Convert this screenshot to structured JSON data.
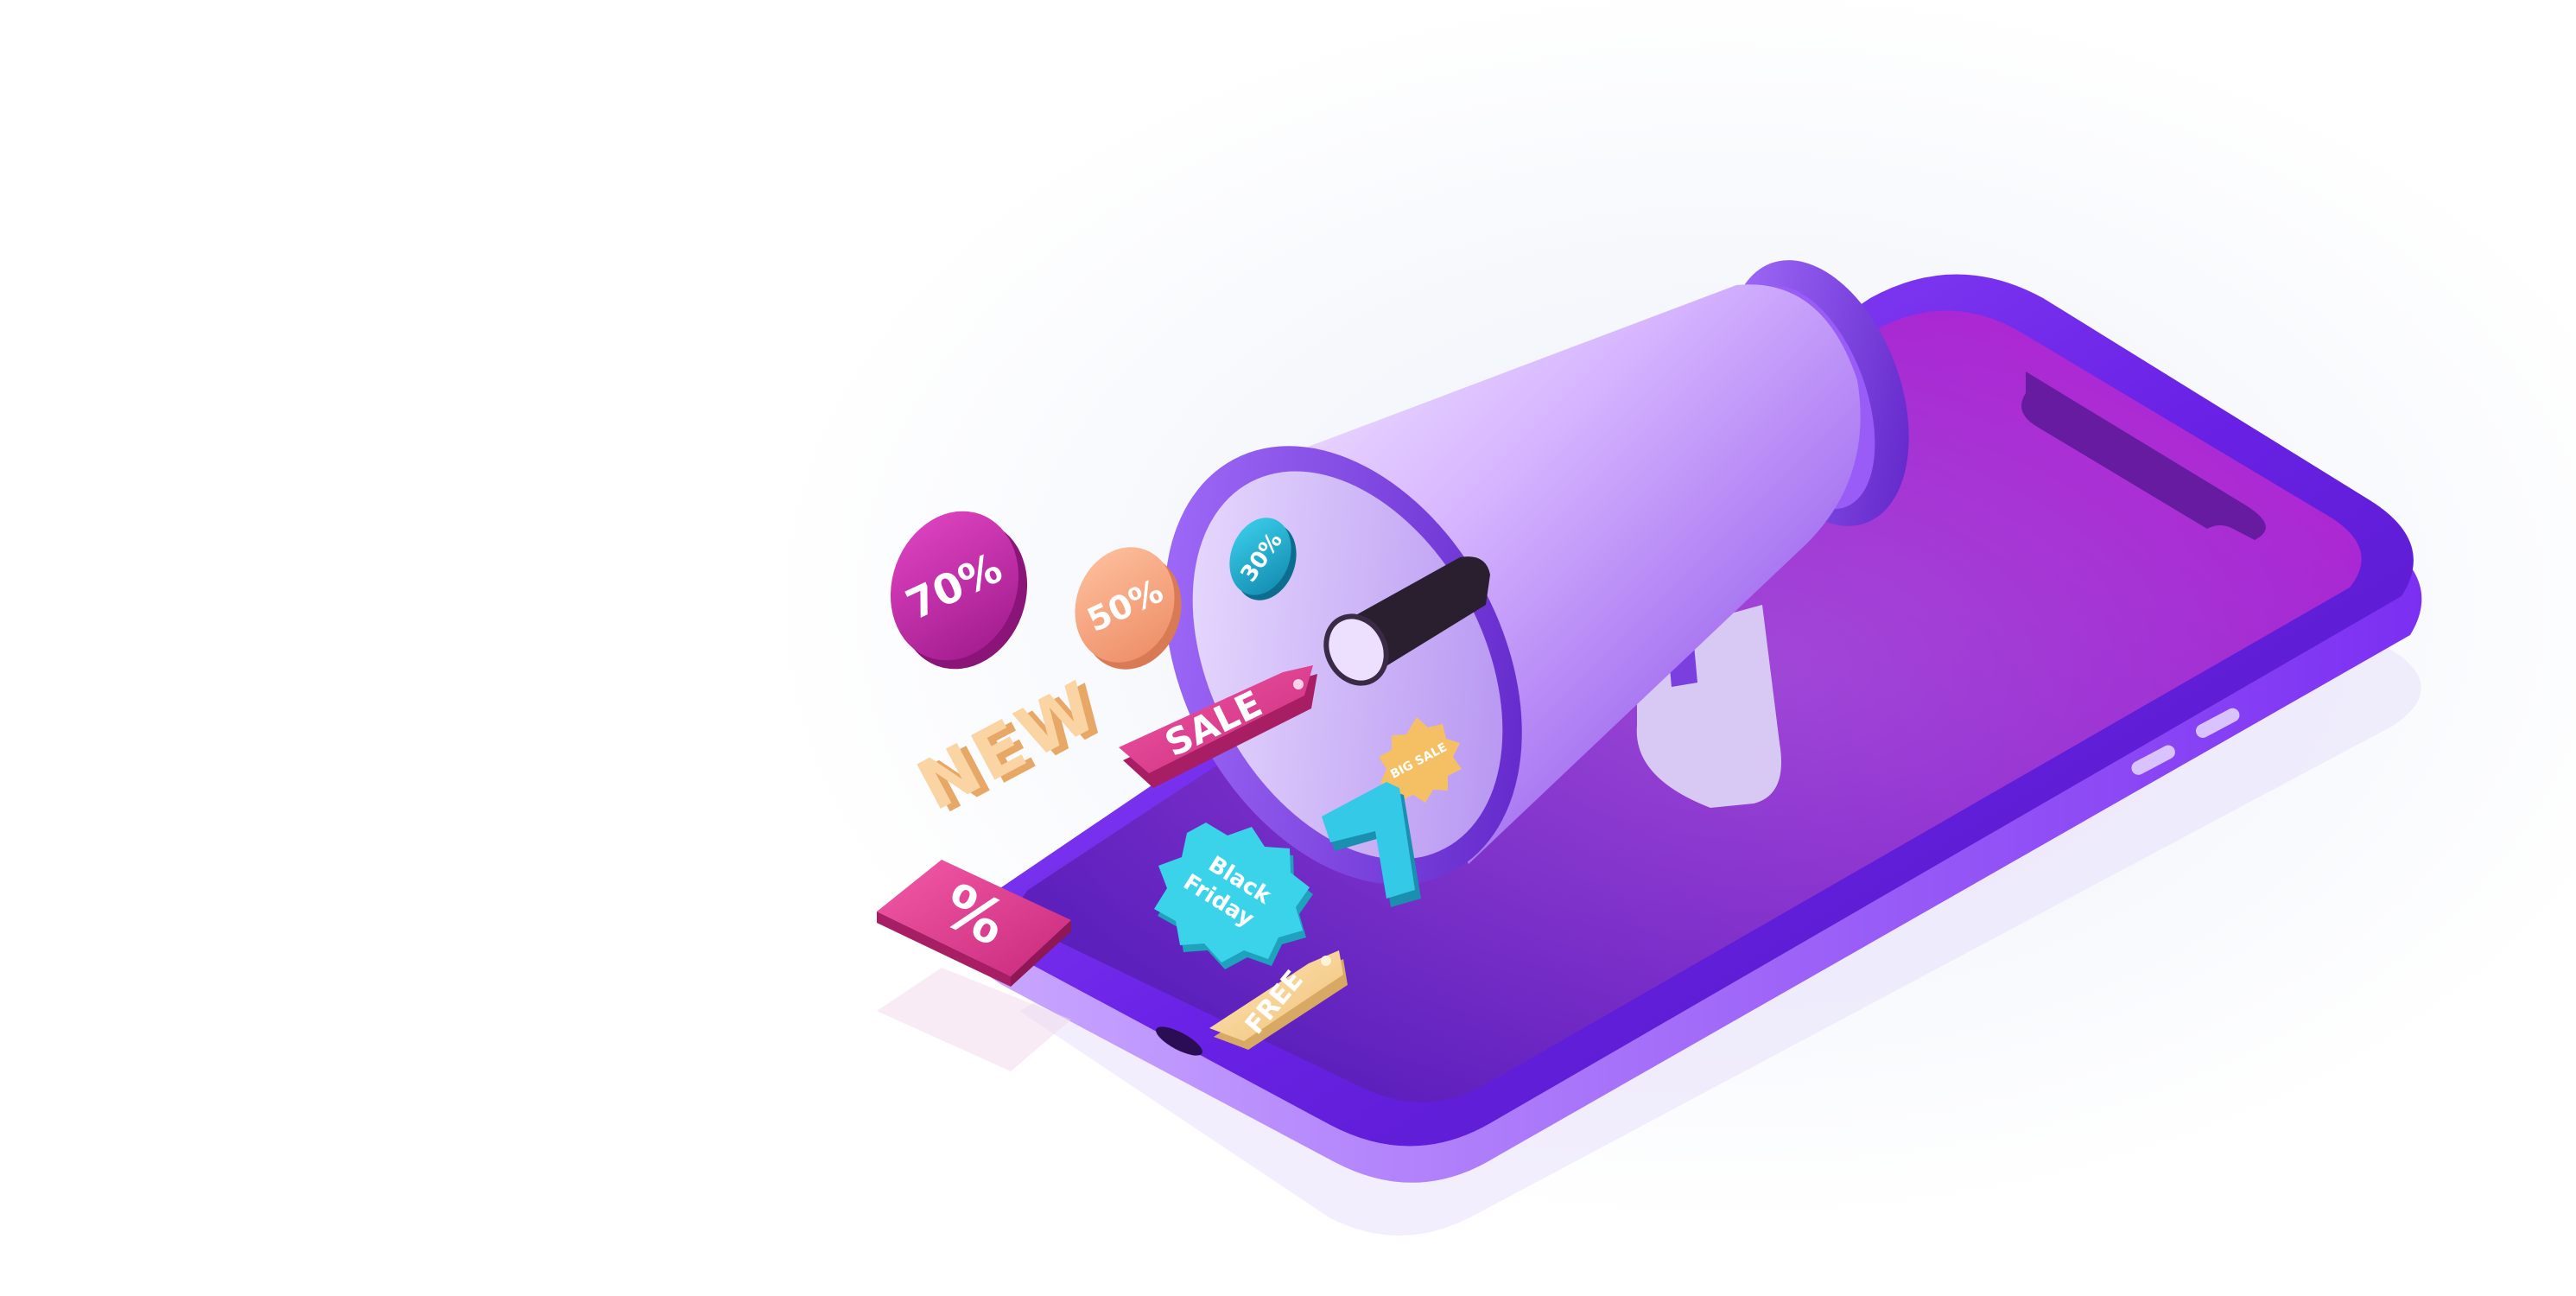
{
  "scene": {
    "description_labels": {
      "coin_70": "70%",
      "coin_50": "50%",
      "coin_30": "30%",
      "new_text": "NEW",
      "sale_tag": "SALE",
      "big_sale_badge": "BIG SALE",
      "black_friday_badge_line1": "Black",
      "black_friday_badge_line2": "Friday",
      "percent_tag": "%",
      "free_tag": "FREE"
    },
    "colors": {
      "phone_body": "#7b2ff2",
      "phone_screen": "#9b1fd6",
      "coin_70": "#c026a8",
      "coin_50": "#f3a27a",
      "coin_30": "#1aa7c9",
      "sale_tag": "#e0418f",
      "percent_tag": "#e0418f",
      "black_friday_badge": "#33c7dc",
      "big_sale_badge": "#f6c46b",
      "free_tag": "#f6d59a",
      "new_text": "#f8c98e",
      "megaphone": "#8a4bf0"
    }
  }
}
